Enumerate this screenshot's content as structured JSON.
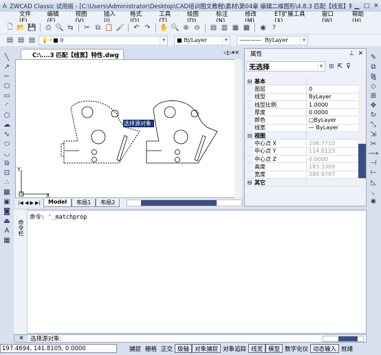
{
  "title": "ZWCAD Classic 试用版 - [C:\\Users\\Administrator\\Desktop\\CAD培训图文教程\\素材\\第04章 编辑二维图形\\4.8.3  匹配【线宽】特性.dwg]",
  "menu": [
    "文件(F)",
    "编辑(E)",
    "视图(V)",
    "插入(I)",
    "格式(O)",
    "工具(T)",
    "绘图(D)",
    "标注(N)",
    "修改(M)",
    "ET扩展工具(X)",
    "窗口(W)",
    "帮助(H)"
  ],
  "layer_combo": "0",
  "color_combo": "ByLayer",
  "linetype_combo": "ByLayer",
  "doc_tab": "C:\\....3  匹配【线宽】特性.dwg",
  "canvas": {
    "tooltip": "选择源对象:",
    "axis_x": "X",
    "axis_y": "Y"
  },
  "layout_tabs": [
    "Model",
    "布局1",
    "布局2"
  ],
  "properties": {
    "title": "属性",
    "selection": "无选择",
    "rows": [
      {
        "cat": true,
        "k": "基本",
        "v": ""
      },
      {
        "k": "图层",
        "v": "0"
      },
      {
        "k": "线型",
        "v": "ByLayer"
      },
      {
        "k": "线型比例",
        "v": "1.0000"
      },
      {
        "k": "厚度",
        "v": "0.0000"
      },
      {
        "k": "颜色",
        "v": "□ByLayer"
      },
      {
        "k": "线宽",
        "v": "— ByLayer"
      },
      {
        "cat": true,
        "k": "视图",
        "v": ""
      },
      {
        "k": "中心点 X",
        "v": "208.7710",
        "g": true
      },
      {
        "k": "中心点 Y",
        "v": "114.8123",
        "g": true
      },
      {
        "k": "中心点 Z",
        "v": "0.0000",
        "g": true
      },
      {
        "k": "高度",
        "v": "183.3368",
        "g": true
      },
      {
        "k": "宽度",
        "v": "289.9797",
        "g": true
      },
      {
        "cat": true,
        "k": "其它",
        "v": ""
      }
    ]
  },
  "command": {
    "side_label": "命令栏",
    "history": "命令: '_matchprop",
    "prompt": "选择源对象:"
  },
  "status": {
    "coords": "197.4694,  141.8105,  0.0000",
    "buttons": [
      {
        "l": "捕捉",
        "on": false
      },
      {
        "l": "栅格",
        "on": false
      },
      {
        "l": "正交",
        "on": false
      },
      {
        "l": "极轴",
        "on": true
      },
      {
        "l": "对象捕捉",
        "on": true
      },
      {
        "l": "对象追踪",
        "on": false
      },
      {
        "l": "线宽",
        "on": true
      },
      {
        "l": "模型",
        "on": true
      },
      {
        "l": "数字化仪",
        "on": false
      },
      {
        "l": "动态输入",
        "on": true
      },
      {
        "l": "就绪",
        "on": false
      }
    ]
  }
}
